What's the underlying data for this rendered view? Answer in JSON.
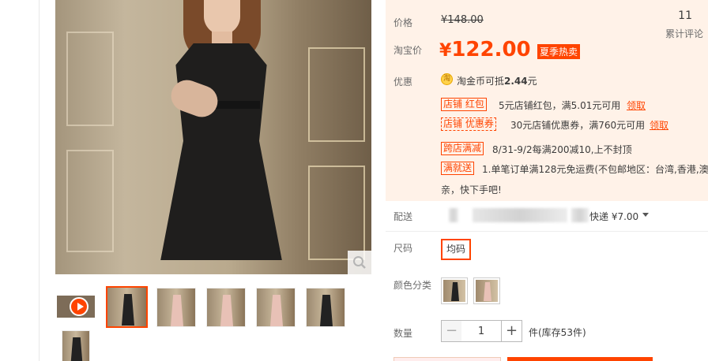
{
  "gallery": {
    "thumbnails": [
      {
        "name": "video",
        "type": "video"
      },
      {
        "name": "black-dress-front",
        "type": "image",
        "color": "black",
        "selected": true
      },
      {
        "name": "pink-dress-front",
        "type": "image",
        "color": "pink"
      },
      {
        "name": "pink-dress-side",
        "type": "image",
        "color": "pink"
      },
      {
        "name": "pink-dress-walk",
        "type": "image",
        "color": "pink"
      },
      {
        "name": "black-dress-side",
        "type": "image",
        "color": "black"
      },
      {
        "name": "black-dress-detail",
        "type": "image",
        "color": "black"
      }
    ]
  },
  "price": {
    "label": "价格",
    "original": "¥148.00"
  },
  "comments": {
    "count": "11",
    "label": "累计评论"
  },
  "taobao_price": {
    "label": "淘宝价",
    "yen": "¥",
    "amount": "122.00",
    "tag": "夏季热卖"
  },
  "promotions": {
    "label": "优惠",
    "coin_icon_text": "淘",
    "coin_text_prefix": "淘金币可抵",
    "coin_amount": "2.44",
    "coin_text_suffix": "元",
    "items": [
      {
        "tag": "店铺 红包",
        "text": "5元店铺红包，满5.01元可用",
        "link": "领取"
      },
      {
        "tag": "店铺 优惠券",
        "text": "30元店铺优惠券，满760元可用",
        "link": "领取"
      },
      {
        "tag": "跨店满减",
        "text": "8/31-9/2每满200减10,上不封顶"
      },
      {
        "tag": "满就送",
        "text": "1.单笔订单满128元免运费(不包邮地区：台湾,香港,澳",
        "text_line2": "亲，快下手吧!"
      }
    ]
  },
  "delivery": {
    "label": "配送",
    "method": "快递 ¥7.00"
  },
  "size": {
    "label": "尺码",
    "options": [
      "均码"
    ],
    "selected": "均码"
  },
  "color": {
    "label": "颜色分类",
    "options": [
      {
        "name": "black-dress",
        "swatch": "#222222"
      },
      {
        "name": "pink-dress",
        "swatch": "#e8c1b6"
      }
    ]
  },
  "quantity": {
    "label": "数量",
    "minus": "−",
    "value": "1",
    "plus": "+",
    "stock": "件(库存53件)"
  },
  "colors": {
    "accent": "#ff4400",
    "price_bg": "#fff2e8"
  }
}
